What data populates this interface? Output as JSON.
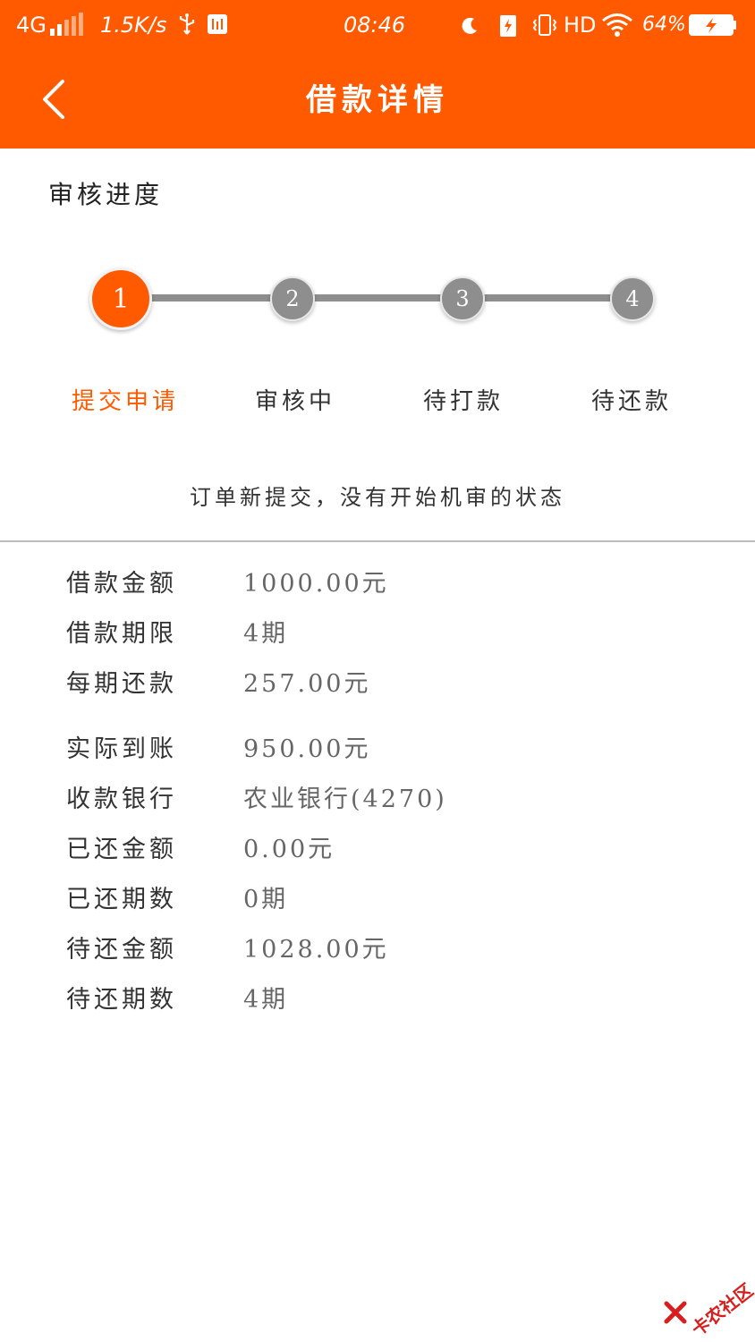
{
  "status_bar": {
    "network": "4G",
    "speed": "1.5K/s",
    "time": "08:46",
    "hd": "HD",
    "battery": "64%",
    "icons": [
      "signal-icon",
      "usb-icon",
      "sim-icon",
      "moon-icon",
      "charging-icon",
      "vibrate-icon",
      "wifi-icon",
      "battery-icon"
    ]
  },
  "header": {
    "title": "借款详情",
    "back_icon": "chevron-left-icon"
  },
  "progress": {
    "section_title": "审核进度",
    "current_step": 1,
    "steps": [
      {
        "number": "1",
        "label": "提交申请"
      },
      {
        "number": "2",
        "label": "审核中"
      },
      {
        "number": "3",
        "label": "待打款"
      },
      {
        "number": "4",
        "label": "待还款"
      }
    ],
    "description": "订单新提交，没有开始机审的状态"
  },
  "details": {
    "rows": [
      {
        "label": "借款金额",
        "value": "1000.00元"
      },
      {
        "label": "借款期限",
        "value": "4期"
      },
      {
        "label": "每期还款",
        "value": "257.00元"
      },
      {
        "label": "实际到账",
        "value": "950.00元"
      },
      {
        "label": "收款银行",
        "value": "农业银行(4270)"
      },
      {
        "label": "已还金额",
        "value": "0.00元"
      },
      {
        "label": "已还期数",
        "value": "0期"
      },
      {
        "label": "待还金额",
        "value": "1028.00元"
      },
      {
        "label": "待还期数",
        "value": "4期"
      }
    ]
  },
  "watermark": {
    "text": "卡农社区"
  },
  "colors": {
    "accent": "#ff5a00",
    "inactive": "#8e8e8e",
    "divider": "#bdbdbd"
  }
}
